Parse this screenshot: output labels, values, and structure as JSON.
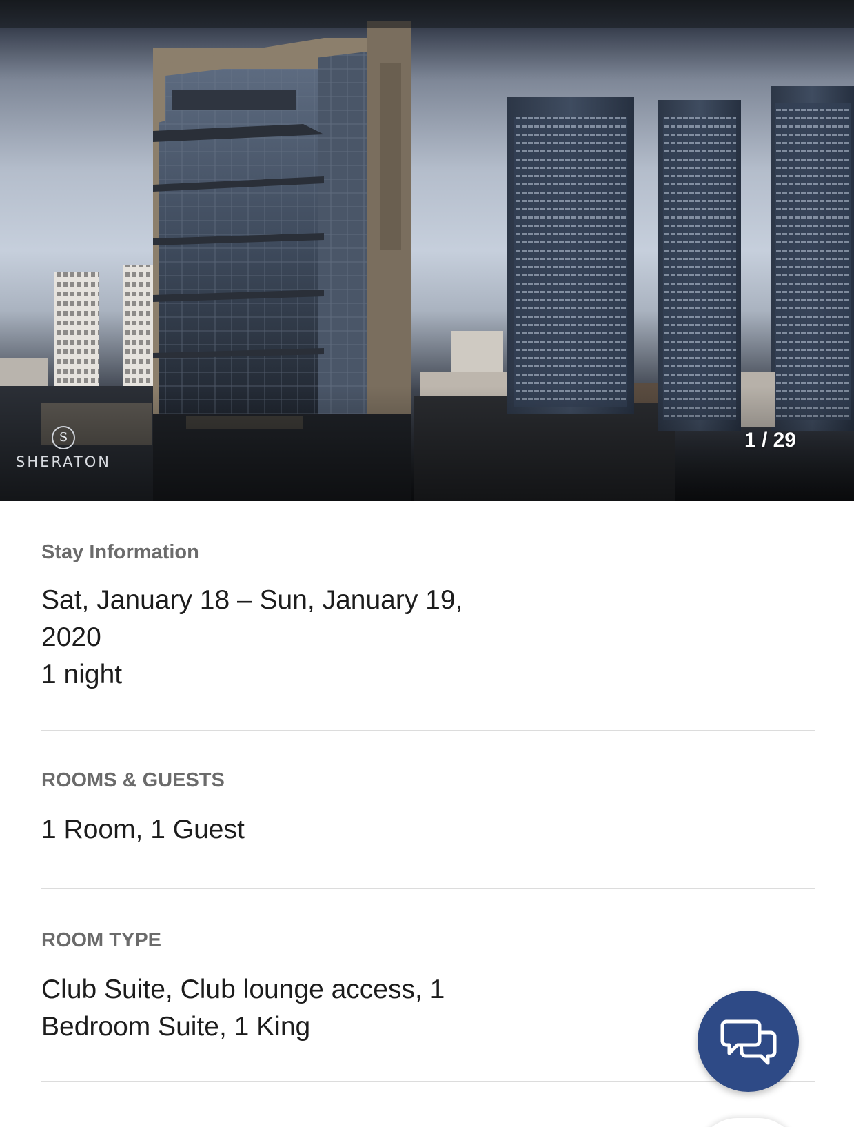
{
  "hero": {
    "brand_name": "SHERATON",
    "brand_mark": "S",
    "photo_counter": "1 / 29"
  },
  "stay": {
    "label": "Stay Information",
    "dates": "Sat, January 18 – Sun, January 19, 2020",
    "nights": "1 night"
  },
  "rooms_guests": {
    "label": "ROOMS & GUESTS",
    "value": "1 Room, 1 Guest"
  },
  "room_type": {
    "label": "ROOM TYPE",
    "value": "Club Suite, Club lounge access, 1 Bedroom Suite, 1 King"
  },
  "chat": {
    "icon": "chat-bubbles-icon",
    "color": "#2e4a86"
  }
}
